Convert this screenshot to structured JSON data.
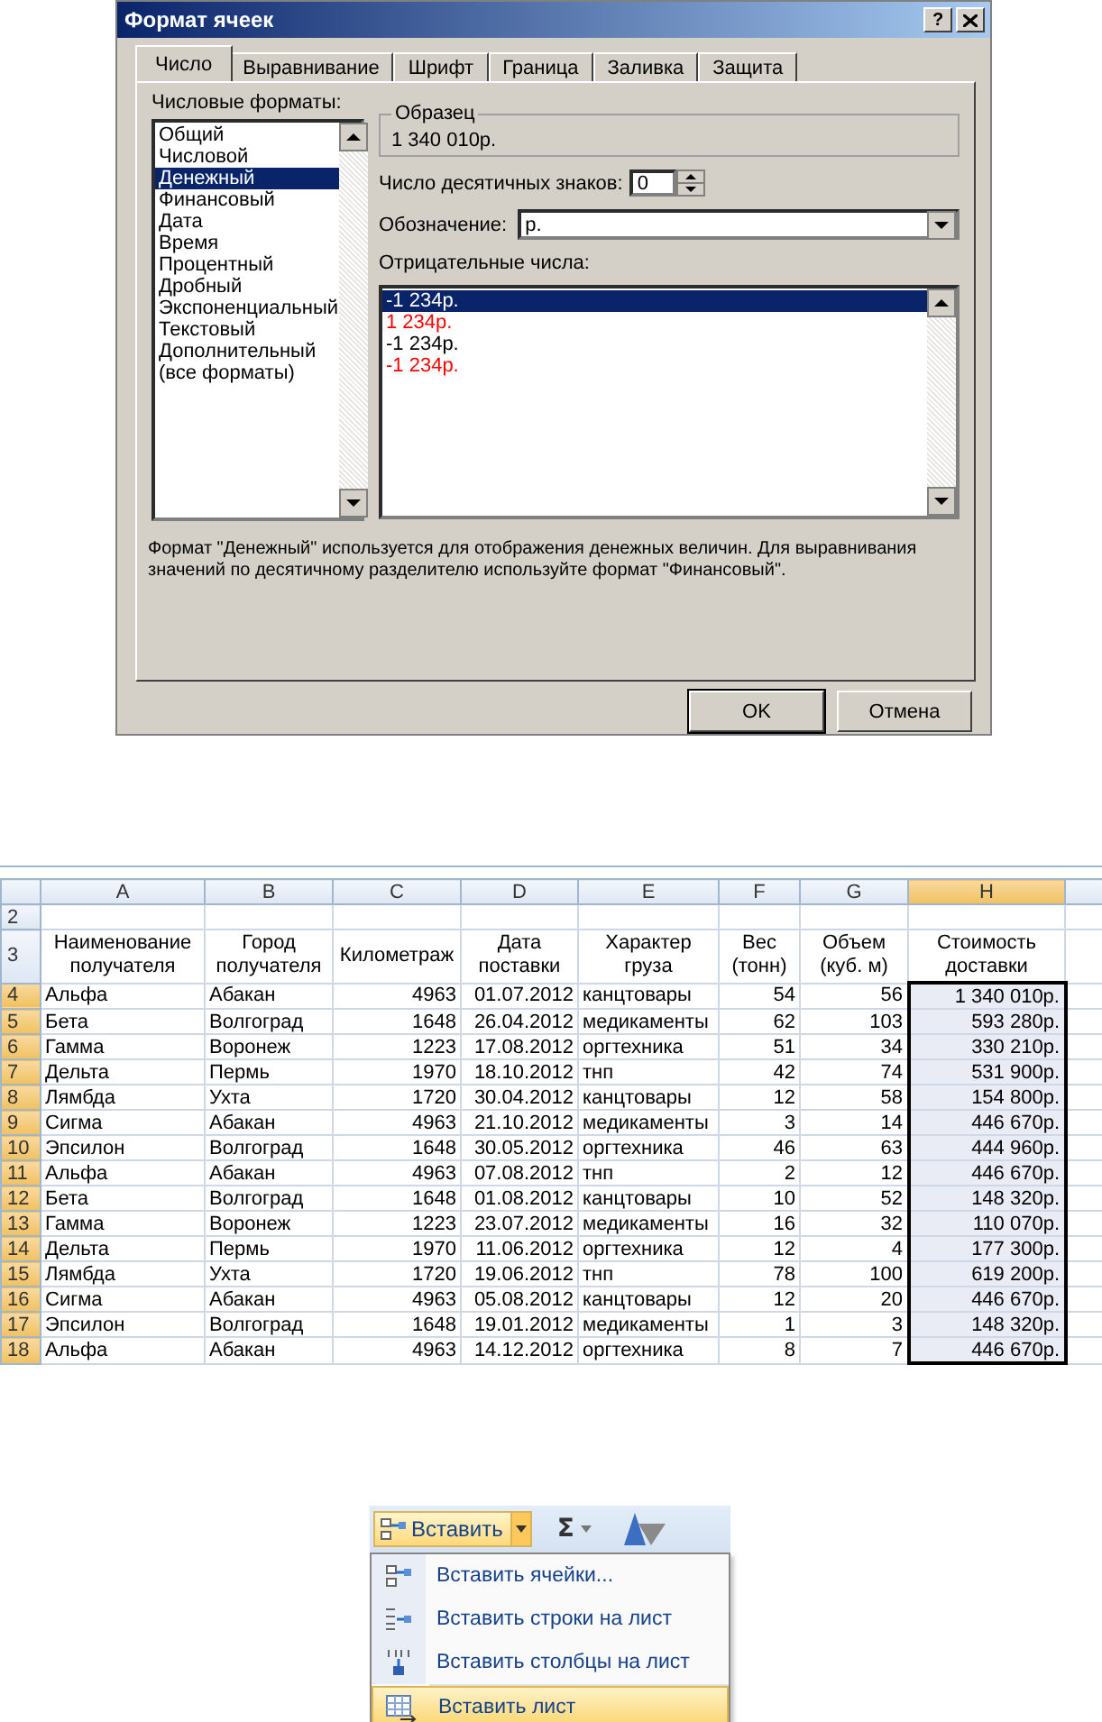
{
  "format_dialog": {
    "title": "Формат ячеек",
    "help_button": "?",
    "tabs": [
      {
        "label": "Число",
        "selected": true
      },
      {
        "label": "Выравнивание",
        "selected": false
      },
      {
        "label": "Шрифт",
        "selected": false
      },
      {
        "label": "Граница",
        "selected": false
      },
      {
        "label": "Заливка",
        "selected": false
      },
      {
        "label": "Защита",
        "selected": false
      }
    ],
    "formats_label": "Числовые форматы:",
    "formats": [
      {
        "label": "Общий",
        "selected": false
      },
      {
        "label": "Числовой",
        "selected": false
      },
      {
        "label": "Денежный",
        "selected": true
      },
      {
        "label": "Финансовый",
        "selected": false
      },
      {
        "label": "Дата",
        "selected": false
      },
      {
        "label": "Время",
        "selected": false
      },
      {
        "label": "Процентный",
        "selected": false
      },
      {
        "label": "Дробный",
        "selected": false
      },
      {
        "label": "Экспоненциальный",
        "selected": false
      },
      {
        "label": "Текстовый",
        "selected": false
      },
      {
        "label": "Дополнительный",
        "selected": false
      },
      {
        "label": "(все форматы)",
        "selected": false
      }
    ],
    "sample": {
      "title": "Образец",
      "value": "1 340 010р."
    },
    "decimals": {
      "label": "Число десятичных знаков:",
      "value": "0"
    },
    "symbol": {
      "label": "Обозначение:",
      "value": "р."
    },
    "negatives_label": "Отрицательные числа:",
    "negative_formats": [
      {
        "label": "-1 234р.",
        "red": false,
        "selected": true
      },
      {
        "label": "1 234р.",
        "red": true,
        "selected": false
      },
      {
        "label": "-1 234р.",
        "red": false,
        "selected": false
      },
      {
        "label": "-1 234р.",
        "red": true,
        "selected": false
      }
    ],
    "description": "Формат \"Денежный\" используется для отображения денежных величин. Для выравнивания значений по десятичному разделителю используйте формат \"Финансовый\".",
    "buttons": [
      {
        "label": "OK",
        "default": true
      },
      {
        "label": "Отмена",
        "default": false
      }
    ]
  },
  "spreadsheet": {
    "columns": [
      {
        "label": "A",
        "kind": "text",
        "selected": false
      },
      {
        "label": "B",
        "kind": "text",
        "selected": false
      },
      {
        "label": "C",
        "kind": "number",
        "selected": false
      },
      {
        "label": "D",
        "kind": "number",
        "selected": false
      },
      {
        "label": "E",
        "kind": "text",
        "selected": false
      },
      {
        "label": "F",
        "kind": "number",
        "selected": false
      },
      {
        "label": "G",
        "kind": "number",
        "selected": false
      },
      {
        "label": "H",
        "kind": "number",
        "selected": true
      }
    ],
    "rows": [
      {
        "number": "2",
        "kind": "blank",
        "selected": false
      },
      {
        "number": "3",
        "kind": "header",
        "selected": false,
        "cells": [
          "Наименование\nполучателя",
          "Город\nполучателя",
          "Километраж",
          "Дата\nпоставки",
          "Характер\nгруза",
          "Вес\n(тонн)",
          "Объем\n(куб. м)",
          "Стоимость\nдоставки"
        ]
      },
      {
        "number": "4",
        "kind": "data",
        "selected": true,
        "cells": [
          "Альфа",
          "Абакан",
          "4963",
          "01.07.2012",
          "канцтовары",
          "54",
          "56",
          "1 340 010р."
        ]
      },
      {
        "number": "5",
        "kind": "data",
        "selected": true,
        "cells": [
          "Бета",
          "Волгоград",
          "1648",
          "26.04.2012",
          "медикаменты",
          "62",
          "103",
          "593 280р."
        ]
      },
      {
        "number": "6",
        "kind": "data",
        "selected": true,
        "cells": [
          "Гамма",
          "Воронеж",
          "1223",
          "17.08.2012",
          "оргтехника",
          "51",
          "34",
          "330 210р."
        ]
      },
      {
        "number": "7",
        "kind": "data",
        "selected": true,
        "cells": [
          "Дельта",
          "Пермь",
          "1970",
          "18.10.2012",
          "тнп",
          "42",
          "74",
          "531 900р."
        ]
      },
      {
        "number": "8",
        "kind": "data",
        "selected": true,
        "cells": [
          "Лямбда",
          "Ухта",
          "1720",
          "30.04.2012",
          "канцтовары",
          "12",
          "58",
          "154 800р."
        ]
      },
      {
        "number": "9",
        "kind": "data",
        "selected": true,
        "cells": [
          "Сигма",
          "Абакан",
          "4963",
          "21.10.2012",
          "медикаменты",
          "3",
          "14",
          "446 670р."
        ]
      },
      {
        "number": "10",
        "kind": "data",
        "selected": true,
        "cells": [
          "Эпсилон",
          "Волгоград",
          "1648",
          "30.05.2012",
          "оргтехника",
          "46",
          "63",
          "444 960р."
        ]
      },
      {
        "number": "11",
        "kind": "data",
        "selected": true,
        "cells": [
          "Альфа",
          "Абакан",
          "4963",
          "07.08.2012",
          "тнп",
          "2",
          "12",
          "446 670р."
        ]
      },
      {
        "number": "12",
        "kind": "data",
        "selected": true,
        "cells": [
          "Бета",
          "Волгоград",
          "1648",
          "01.08.2012",
          "канцтовары",
          "10",
          "52",
          "148 320р."
        ]
      },
      {
        "number": "13",
        "kind": "data",
        "selected": true,
        "cells": [
          "Гамма",
          "Воронеж",
          "1223",
          "23.07.2012",
          "медикаменты",
          "16",
          "32",
          "110 070р."
        ]
      },
      {
        "number": "14",
        "kind": "data",
        "selected": true,
        "cells": [
          "Дельта",
          "Пермь",
          "1970",
          "11.06.2012",
          "оргтехника",
          "12",
          "4",
          "177 300р."
        ]
      },
      {
        "number": "15",
        "kind": "data",
        "selected": true,
        "cells": [
          "Лямбда",
          "Ухта",
          "1720",
          "19.06.2012",
          "тнп",
          "78",
          "100",
          "619 200р."
        ]
      },
      {
        "number": "16",
        "kind": "data",
        "selected": true,
        "cells": [
          "Сигма",
          "Абакан",
          "4963",
          "05.08.2012",
          "канцтовары",
          "12",
          "20",
          "446 670р."
        ]
      },
      {
        "number": "17",
        "kind": "data",
        "selected": true,
        "cells": [
          "Эпсилон",
          "Волгоград",
          "1648",
          "19.01.2012",
          "медикаменты",
          "1",
          "3",
          "148 320р."
        ]
      },
      {
        "number": "18",
        "kind": "data",
        "selected": true,
        "cells": [
          "Альфа",
          "Абакан",
          "4963",
          "14.12.2012",
          "оргтехника",
          "8",
          "7",
          "446 670р."
        ]
      }
    ]
  },
  "insert_menu": {
    "button": "Вставить",
    "sum_button": "Σ",
    "items": [
      {
        "label": "Вставить ячейки...",
        "selected": false
      },
      {
        "label": "Вставить строки на лист",
        "selected": false
      },
      {
        "label": "Вставить столбцы на лист",
        "selected": false
      },
      {
        "label": "Вставить лист",
        "selected": true
      }
    ]
  }
}
